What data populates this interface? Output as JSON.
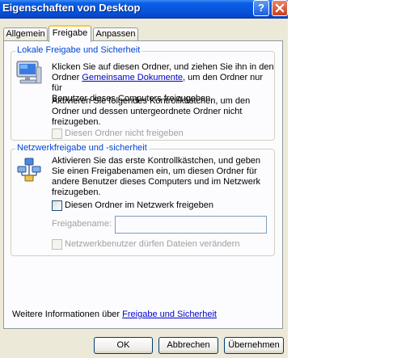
{
  "window": {
    "title": "Eigenschaften von Desktop",
    "help_button": "?",
    "close_button": "✕"
  },
  "tabs": [
    {
      "label": "Allgemein",
      "active": false
    },
    {
      "label": "Freigabe",
      "active": true
    },
    {
      "label": "Anpassen",
      "active": false
    }
  ],
  "local_group": {
    "title": "Lokale Freigabe und Sicherheit",
    "icon": "computer-icon",
    "paragraph1_line1": "Klicken Sie auf diesen Ordner, und ziehen Sie ihn in den",
    "paragraph1_pre": "Ordner ",
    "paragraph1_link": "Gemeinsame Dokumente",
    "paragraph1_post": ", um den Ordner nur für",
    "paragraph1_line3": "Benutzer dieses Computers freizugeben.",
    "paragraph2_line1": "Aktivieren Sie folgendes Kontrollkästchen, um den",
    "paragraph2_line2": "Ordner und dessen untergeordnete Ordner nicht",
    "paragraph2_line3": "freizugeben.",
    "checkbox_label": "Diesen Ordner nicht freigeben",
    "checkbox_checked": false,
    "checkbox_enabled": false
  },
  "network_group": {
    "title": "Netzwerkfreigabe und -sicherheit",
    "icon": "network-share-icon",
    "line1": "Aktivieren Sie das erste Kontrollkästchen, und geben",
    "line2": "Sie einen Freigabenamen ein, um diesen Ordner für",
    "line3": "andere Benutzer dieses Computers und im Netzwerk",
    "line4": "freizugeben.",
    "share_checkbox_label": "Diesen Ordner im Netzwerk freigeben",
    "share_checkbox_checked": false,
    "share_name_label": "Freigabename:",
    "share_name_value": "",
    "modify_checkbox_label": "Netzwerkbenutzer dürfen Dateien verändern",
    "modify_checkbox_checked": false,
    "modify_checkbox_enabled": false
  },
  "info": {
    "text": "Weitere Informationen über ",
    "link": "Freigabe und Sicherheit"
  },
  "buttons": {
    "ok": "OK",
    "cancel": "Abbrechen",
    "apply": "Übernehmen"
  },
  "colors": {
    "titlebar": "#0855dd",
    "dialog_bg": "#ece9d8",
    "panel_bg": "#fcfcfe",
    "group_title": "#0046d5",
    "link": "#0000cc",
    "active_tab_accent": "#ffc83c"
  }
}
